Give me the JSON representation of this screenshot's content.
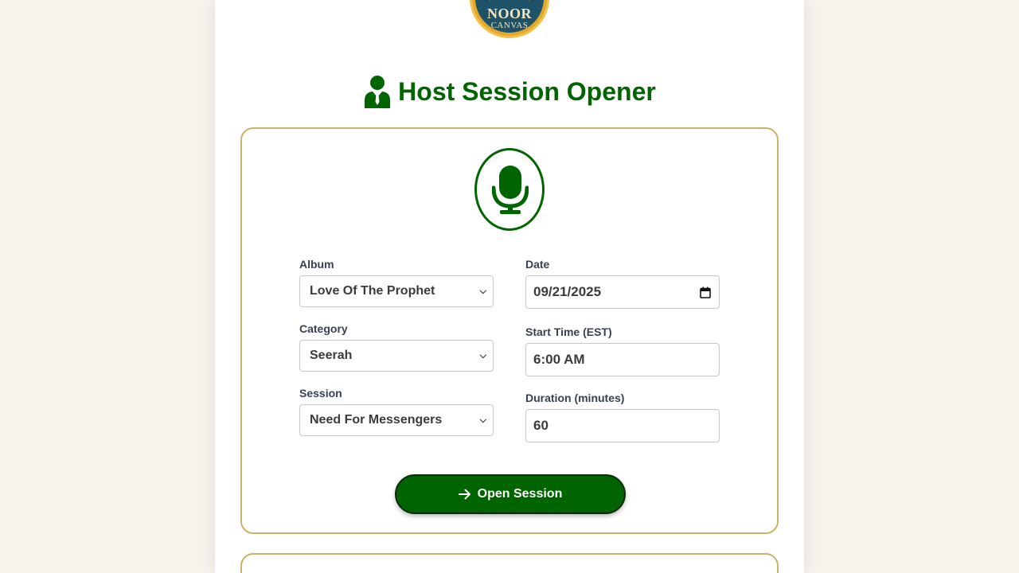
{
  "brand": {
    "logo_line1": "NOOR",
    "logo_line2": "CANVAS"
  },
  "header": {
    "title": "Host Session Opener",
    "icon": "user-tie-icon"
  },
  "form": {
    "icon": "microphone-icon",
    "album": {
      "label": "Album",
      "value": "Love Of The Prophet"
    },
    "category": {
      "label": "Category",
      "value": "Seerah"
    },
    "session": {
      "label": "Session",
      "value": "Need For Messengers"
    },
    "date": {
      "label": "Date",
      "value": "09/21/2025"
    },
    "start_time": {
      "label": "Start Time (EST)",
      "value": "6:00 AM"
    },
    "duration": {
      "label": "Duration (minutes)",
      "value": "60"
    },
    "submit_label": "Open Session",
    "submit_icon": "arrow-right-icon"
  },
  "colors": {
    "primary": "#006400",
    "border": "#c9b36a",
    "background": "#f7f4ee"
  }
}
